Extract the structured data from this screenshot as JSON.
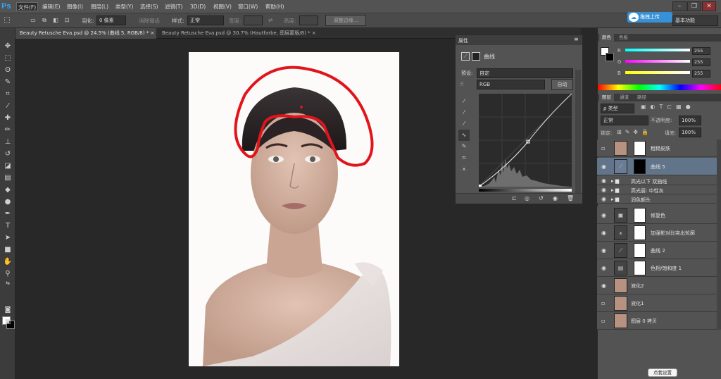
{
  "app": {
    "logo": "Ps"
  },
  "menu": [
    "文件(F)",
    "编辑(E)",
    "图像(I)",
    "图层(L)",
    "类型(Y)",
    "选择(S)",
    "滤镜(T)",
    "3D(D)",
    "视图(V)",
    "窗口(W)",
    "帮助(H)"
  ],
  "window_buttons": [
    "–",
    "❐",
    "✕"
  ],
  "options": {
    "feather_label": "羽化:",
    "feather_value": "0 像素",
    "antialias_label": "消除锯齿",
    "style_label": "样式:",
    "style_value": "正常",
    "width_label": "宽度:",
    "height_label": "高度:",
    "refine_button": "调整边缘...",
    "upload_button": "拖拽上传",
    "workspace": "基本功能"
  },
  "tabs": [
    {
      "label": "Beauty Retusche Eva.psd @ 24.5% (曲线 5, RGB/8) *",
      "close": "×"
    },
    {
      "label": "Beauty Retusche Eva.psd @ 30.7% (Hautfarbe, 图层蒙版/8) *",
      "close": "×"
    }
  ],
  "properties": {
    "panel_title": "属性",
    "type_title": "曲线",
    "preset_label": "预设:",
    "preset_value": "自定",
    "channel_value": "RGB",
    "auto_button": "自动"
  },
  "color_panel": {
    "tabs": [
      "颜色",
      "色板"
    ],
    "channels": [
      {
        "label": "R",
        "value": "255",
        "color": "#ff0000"
      },
      {
        "label": "G",
        "value": "255",
        "color": "#00ff00"
      },
      {
        "label": "B",
        "value": "255",
        "color": "#0000ff"
      }
    ]
  },
  "layers_panel": {
    "tabs": [
      "图层",
      "通道",
      "路径"
    ],
    "filter_label": "ρ 类型",
    "blend_mode": "正常",
    "opacity_label": "不透明度:",
    "opacity_value": "100%",
    "lock_label": "锁定:",
    "fill_label": "填充:",
    "fill_value": "100%",
    "layers": [
      {
        "name": "粗糙皮肤",
        "visible": false,
        "kind": "photo-mask",
        "selected": false
      },
      {
        "name": "曲线 5",
        "visible": true,
        "kind": "curves-mask",
        "selected": true
      },
      {
        "name": "高光以下 双曲线",
        "visible": true,
        "kind": "folder",
        "selected": false
      },
      {
        "name": "高光层: 中性灰",
        "visible": true,
        "kind": "folder",
        "selected": false
      },
      {
        "name": "润色额头",
        "visible": true,
        "kind": "folder",
        "selected": false
      },
      {
        "name": "修复色",
        "visible": true,
        "kind": "fill-mask",
        "selected": false
      },
      {
        "name": "加强影对比突出轮廓",
        "visible": true,
        "kind": "levels-mask",
        "selected": false
      },
      {
        "name": "曲线 2",
        "visible": true,
        "kind": "curves-mask",
        "selected": false
      },
      {
        "name": "色相/饱和度 1",
        "visible": true,
        "kind": "hue-mask",
        "selected": false
      },
      {
        "name": "液化2",
        "visible": true,
        "kind": "photo",
        "selected": false
      },
      {
        "name": "液化1",
        "visible": false,
        "kind": "photo",
        "selected": false
      },
      {
        "name": "图层 0 拷贝",
        "visible": false,
        "kind": "photo",
        "selected": false
      }
    ]
  },
  "tooltip": "点我设置"
}
